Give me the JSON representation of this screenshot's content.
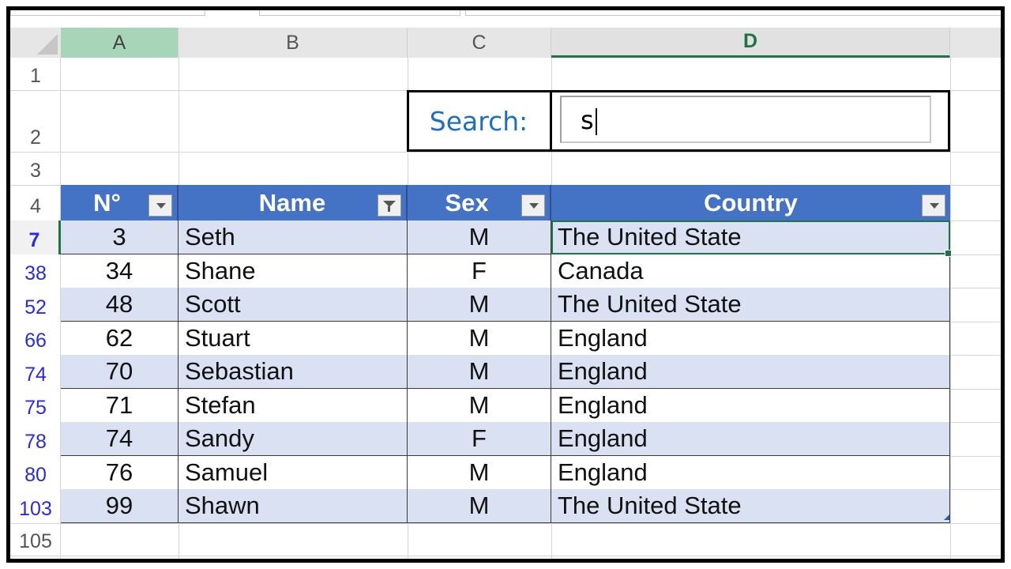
{
  "columns": [
    "A",
    "B",
    "C",
    "D"
  ],
  "row_numbers": {
    "r1": "1",
    "r2": "2",
    "r3": "3",
    "r4": "4",
    "r105": "105"
  },
  "search": {
    "label": "Search:",
    "value": "s"
  },
  "table": {
    "headers": [
      "N°",
      "Name",
      "Sex",
      "Country"
    ],
    "rows": [
      {
        "row_num": "7",
        "num": "3",
        "name": "Seth",
        "sex": "M",
        "country": "The United State"
      },
      {
        "row_num": "38",
        "num": "34",
        "name": "Shane",
        "sex": "F",
        "country": "Canada"
      },
      {
        "row_num": "52",
        "num": "48",
        "name": "Scott",
        "sex": "M",
        "country": "The United State"
      },
      {
        "row_num": "66",
        "num": "62",
        "name": "Stuart",
        "sex": "M",
        "country": "England"
      },
      {
        "row_num": "74",
        "num": "70",
        "name": "Sebastian",
        "sex": "M",
        "country": "England"
      },
      {
        "row_num": "75",
        "num": "71",
        "name": "Stefan",
        "sex": "M",
        "country": "England"
      },
      {
        "row_num": "78",
        "num": "74",
        "name": "Sandy",
        "sex": "F",
        "country": "England"
      },
      {
        "row_num": "80",
        "num": "76",
        "name": "Samuel",
        "sex": "M",
        "country": "England"
      },
      {
        "row_num": "103",
        "num": "99",
        "name": "Shawn",
        "sex": "M",
        "country": "The United State"
      }
    ]
  },
  "colors": {
    "header_blue": "#4472c4",
    "band_blue": "#d9e1f2",
    "excel_green": "#217346",
    "search_label_blue": "#1f6fbf"
  }
}
